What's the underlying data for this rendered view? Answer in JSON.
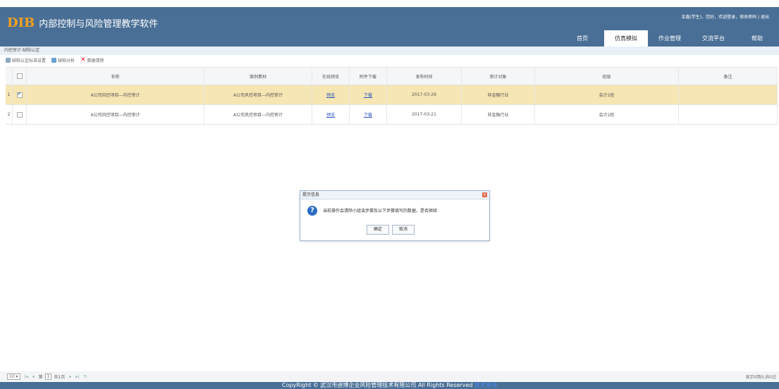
{
  "app": {
    "logo_text": "DIB",
    "title": "内部控制与风险管理教学软件"
  },
  "user_bar": "余鑫(学生)，您好，欢迎登录，修改密码 | 退出",
  "nav": [
    {
      "label": "首页",
      "active": false
    },
    {
      "label": "仿真模拟",
      "active": true
    },
    {
      "label": "作业管理",
      "active": false
    },
    {
      "label": "交流平台",
      "active": false
    },
    {
      "label": "帮助",
      "active": false
    }
  ],
  "breadcrumb": "内控审计-缺陷认定",
  "toolbar": {
    "standard_settings": "缺陷认定标准设置",
    "analysis": "缺陷分析",
    "delete": "数据清除"
  },
  "table": {
    "headers": [
      "",
      "",
      "名称",
      "案例素材",
      "在线预览",
      "附件下载",
      "发布时间",
      "审计对象",
      "班级",
      "备注"
    ],
    "rows": [
      {
        "num": "1",
        "checked": true,
        "name": "A公司风控项目—内控审计",
        "material": "A公司风控项目—内控审计",
        "preview": "预览",
        "download": "下载",
        "date": "2017-03-29",
        "target": "非金融行业",
        "class": "会计2班",
        "note": ""
      },
      {
        "num": "2",
        "checked": false,
        "name": "A公司风控项目—内控审计",
        "material": "A公司风控项目—内控审计",
        "preview": "预览",
        "download": "下载",
        "date": "2017-03-21",
        "target": "非金融行业",
        "class": "会计2班",
        "note": ""
      }
    ]
  },
  "dialog": {
    "title": "提示信息",
    "message": "当前操作会清除小组该步骤及以下步骤填写的数据，是否继续",
    "ok": "确定",
    "cancel": "取消"
  },
  "pager": {
    "page_size": "10",
    "page_label": "第",
    "page_value": "1",
    "page_total": "共1页",
    "info": "显示0到0,共0记"
  },
  "footer": {
    "text": "CopyRight © 武汉市迪博企业风险管理技术有限公司 All Rights Reserved",
    "link": "技术支持"
  }
}
